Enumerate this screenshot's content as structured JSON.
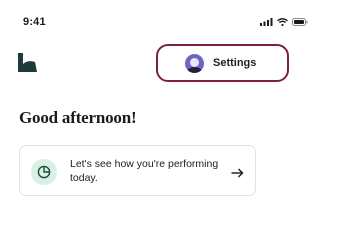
{
  "status_bar": {
    "time": "9:41",
    "icons": [
      "signal-icon",
      "wifi-icon",
      "battery-icon"
    ]
  },
  "header": {
    "logo_icon": "brand-logo-icon",
    "settings": {
      "label": "Settings",
      "avatar": "avatar"
    }
  },
  "main": {
    "greeting": "Good afternoon!",
    "performance_card": {
      "icon": "pie-chart-icon",
      "text": "Let's see how you're performing today.",
      "arrow_icon": "arrow-right-icon"
    }
  },
  "colors": {
    "accent_border": "#7d1f4a",
    "avatar_bg": "#6b67c7",
    "brand_dark": "#1e3a3c",
    "card_icon_bg": "#d9f1e4",
    "card_icon_fg": "#1e4a3a"
  }
}
